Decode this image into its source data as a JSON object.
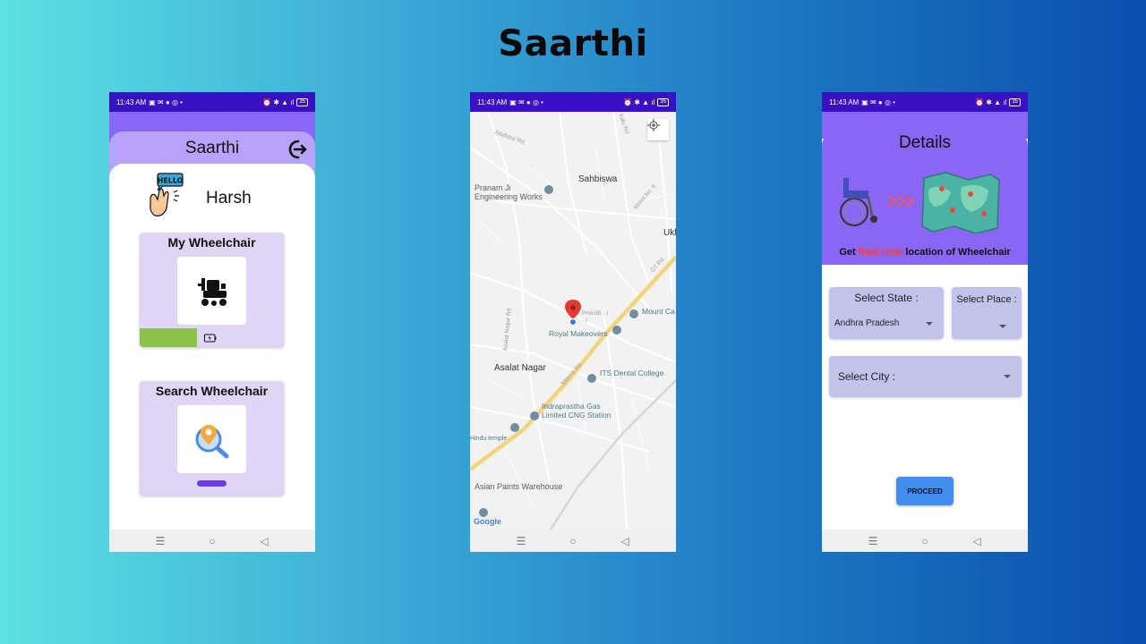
{
  "page": {
    "title": "Saarthi"
  },
  "status_bar": {
    "time": "11:43 AM",
    "battery": "35"
  },
  "home": {
    "title": "Saarthi",
    "user_name": "Harsh",
    "hello_badge": "HELLO",
    "my_wheelchair": {
      "title": "My Wheelchair",
      "battery_level_fraction": 0.4
    },
    "search_wheelchair": {
      "title": "Search Wheelchair"
    }
  },
  "map": {
    "labels": {
      "sahbiswa": "Sahbiswa",
      "pranam": "Pranam Ji\nEngineering Works",
      "ukh": "Ukh",
      "phase": "PHASE - I\n- I",
      "mount": "Mount Ca",
      "royal": "Royal Makeovers",
      "asalat": "Asalat Nagar",
      "its": "ITS Dental College",
      "indraprastha": "Indraprastha Gas\nLimited CNG Station",
      "hindu": "Hindu temple",
      "asian": "Asian Paints Warehouse",
      "jatabpur": "Jatabpur Rd",
      "kalu": "Kalu Rd",
      "street": "Street No. 6",
      "gt": "GT Rd",
      "meerut": "Meerut Rd",
      "asalat_rd": "Asalat Nagar Rd"
    },
    "attribution": "Google"
  },
  "details": {
    "title": "Details",
    "tagline_prefix": "Get",
    "tagline_highlight": "Real-time",
    "tagline_suffix": "location of Wheelchair",
    "state_label": "Select State :",
    "state_value": "Andhra Pradesh",
    "place_label": "Select Place :",
    "city_label": "Select City :",
    "proceed": "PROCEED"
  },
  "colors": {
    "status_bar": "#3a10c2",
    "accent_purple": "#8b66f5",
    "card_bg": "#e1d5f5",
    "battery_green": "#8bc34a",
    "select_bg": "#c2c3ea",
    "proceed_blue": "#3f8ef0",
    "highlight_red": "#ff3b3b"
  }
}
